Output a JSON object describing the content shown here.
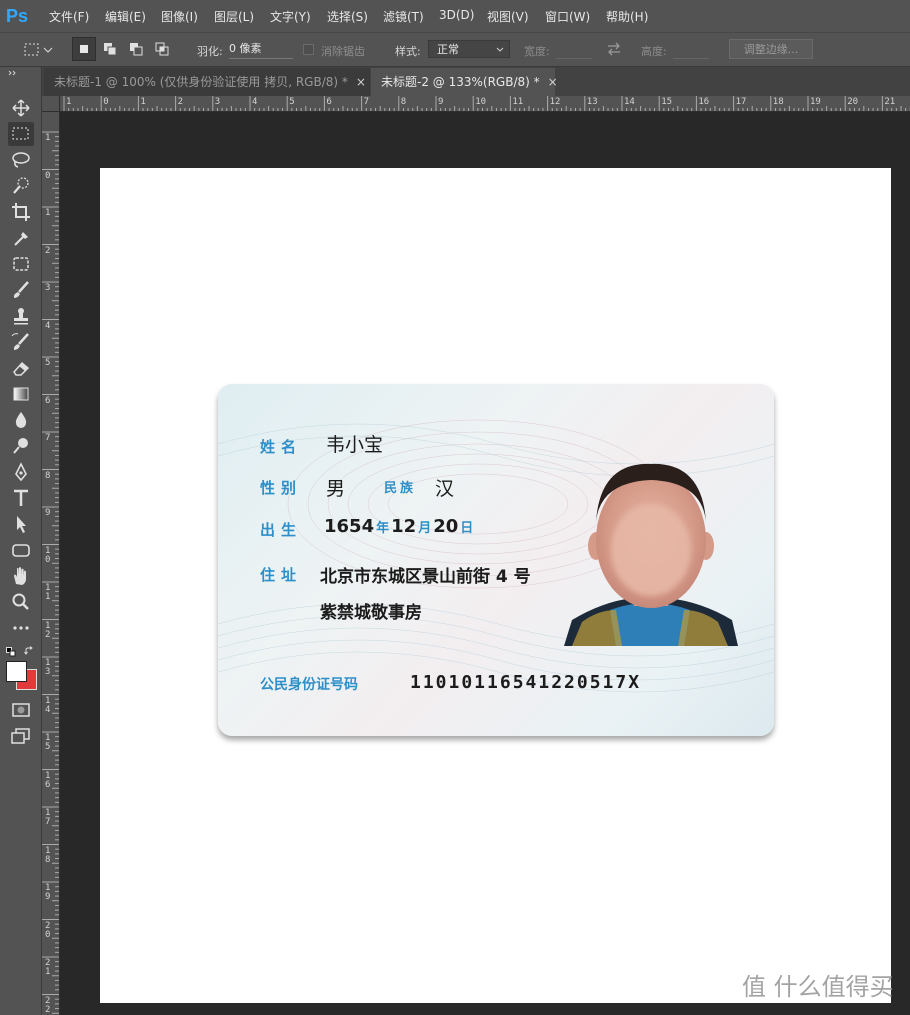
{
  "app": {
    "logo": "Ps",
    "accent": "#31a8ff"
  },
  "menu": {
    "items": [
      "文件(F)",
      "编辑(E)",
      "图像(I)",
      "图层(L)",
      "文字(Y)",
      "选择(S)",
      "滤镜(T)",
      "3D(D)",
      "视图(V)",
      "窗口(W)",
      "帮助(H)"
    ]
  },
  "options": {
    "feather_label": "羽化:",
    "feather_value": "0 像素",
    "antialias_label": "消除锯齿",
    "style_label": "样式:",
    "style_value": "正常",
    "width_label": "宽度:",
    "height_label": "高度:",
    "refine_button": "调整边缘..."
  },
  "tabs": [
    {
      "label": "未标题-1 @ 100% (仅供身份验证使用 拷贝, RGB/8) *",
      "close": "×"
    },
    {
      "label": "未标题-2 @ 133%(RGB/8) *",
      "close": "×"
    }
  ],
  "rulers": {
    "top": [
      "1",
      "0",
      "1",
      "2",
      "3",
      "4",
      "5",
      "6",
      "7",
      "8",
      "9",
      "10",
      "11",
      "12",
      "13",
      "14",
      "15",
      "16",
      "17",
      "18",
      "19",
      "20",
      "21"
    ],
    "left": [
      "1",
      "0",
      "1",
      "2",
      "3",
      "4",
      "5",
      "6",
      "7",
      "8",
      "9",
      "10",
      "11",
      "12",
      "13",
      "14",
      "15",
      "16",
      "17",
      "18",
      "19",
      "20",
      "21",
      "22",
      "23"
    ]
  },
  "colors": {
    "foreground": "#ffffff",
    "background": "#e03a3a"
  },
  "idcard": {
    "name_label": "姓名",
    "name": "韦小宝",
    "sex_label": "性别",
    "sex": "男",
    "ethnic_label": "民族",
    "ethnic": "汉",
    "birth_label": "出生",
    "birth_year": "1654",
    "year_unit": "年",
    "birth_month": "12",
    "month_unit": "月",
    "birth_day": "20",
    "day_unit": "日",
    "address_label": "住址",
    "address_line1": "北京市东城区景山前街 4 号",
    "address_line2": "紫禁城敬事房",
    "id_label": "公民身份证号码",
    "id_number": "11010116541220517X"
  },
  "watermark": "值 什么值得买"
}
